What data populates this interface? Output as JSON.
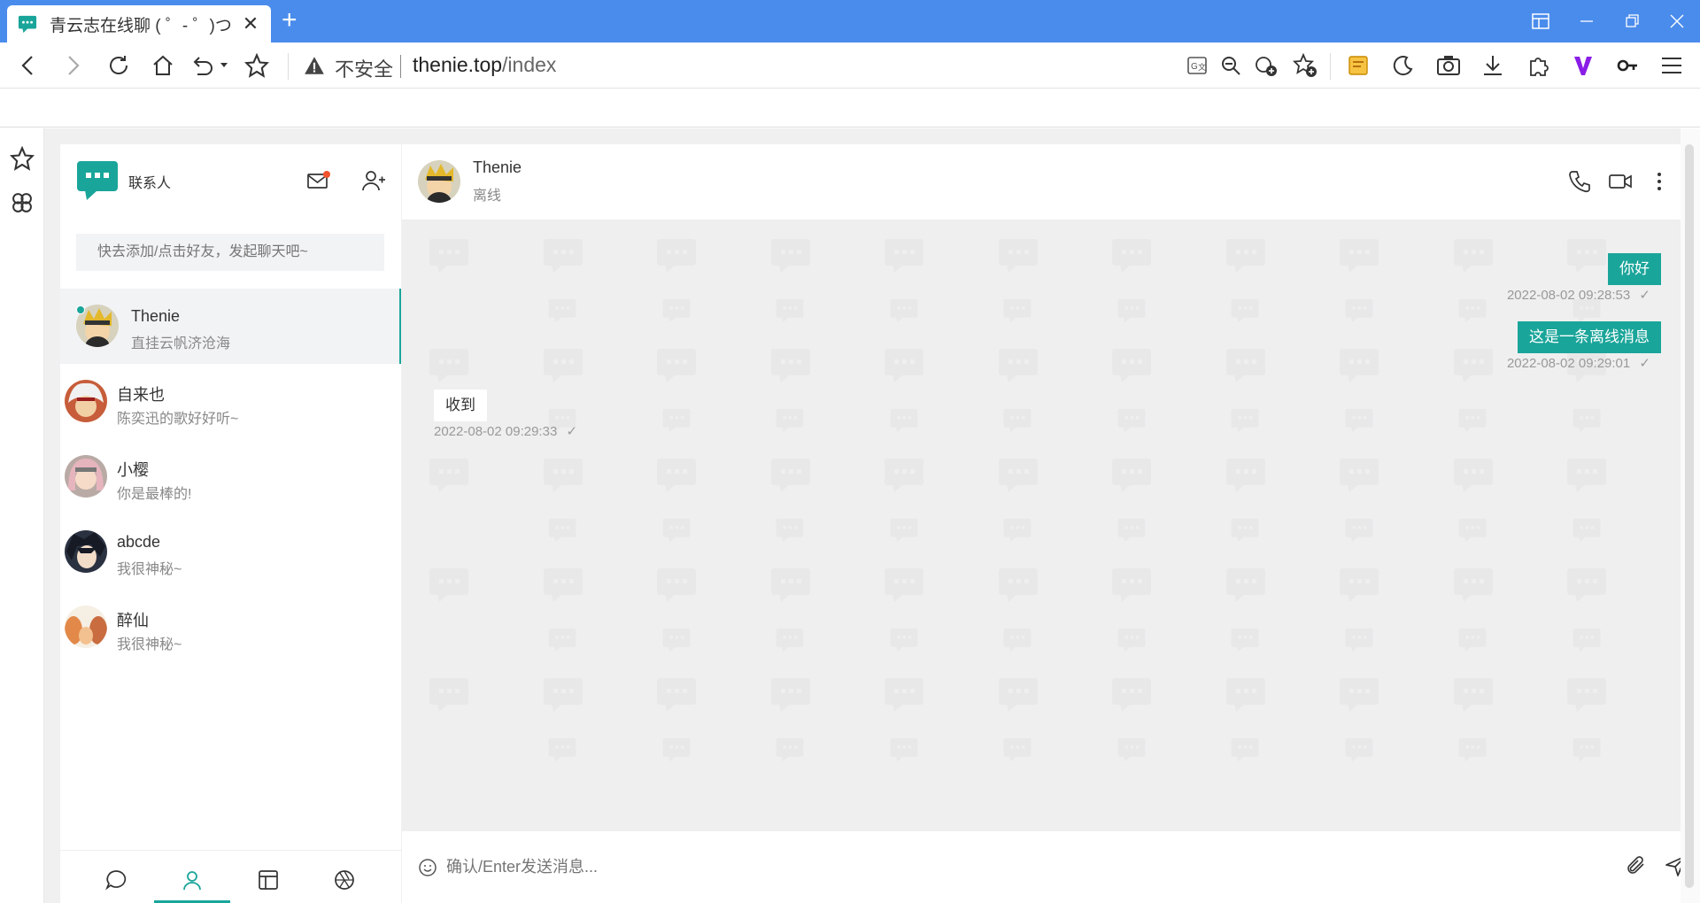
{
  "browser": {
    "tab_title": "青云志在线聊 ( ゜- ゜)つ",
    "address": {
      "security_label": "不安全",
      "host": "thenie.top",
      "path": "/index"
    }
  },
  "app": {
    "contacts_title": "联系人",
    "search_placeholder": "快去添加/点击好友，发起聊天吧~",
    "contacts": [
      {
        "name": "Thenie",
        "message": "直挂云帆济沧海",
        "active": true,
        "online": true
      },
      {
        "name": "自来也",
        "message": "陈奕迅的歌好好听~"
      },
      {
        "name": "小樱",
        "message": "你是最棒的!"
      },
      {
        "name": "abcde",
        "message": "我很神秘~"
      },
      {
        "name": "醉仙",
        "message": "我很神秘~"
      }
    ],
    "chat": {
      "name": "Thenie",
      "status": "离线",
      "messages": [
        {
          "direction": "out",
          "text": "你好",
          "time": "2022-08-02 09:28:53"
        },
        {
          "direction": "out",
          "text": "这是一条离线消息",
          "time": "2022-08-02 09:29:01"
        },
        {
          "direction": "in",
          "text": "收到",
          "time": "2022-08-02 09:29:33"
        }
      ],
      "input_placeholder": "确认/Enter发送消息..."
    }
  },
  "colors": {
    "accent": "#1aa59a",
    "titlebar": "#4a8cec",
    "chat_bg": "#efeff0",
    "notify": "#f2542d"
  },
  "icons": {
    "footer": [
      "chat-icon",
      "contacts-icon",
      "layout-icon",
      "aperture-icon"
    ],
    "chat_header": [
      "phone-icon",
      "video-icon",
      "more-icon"
    ]
  }
}
